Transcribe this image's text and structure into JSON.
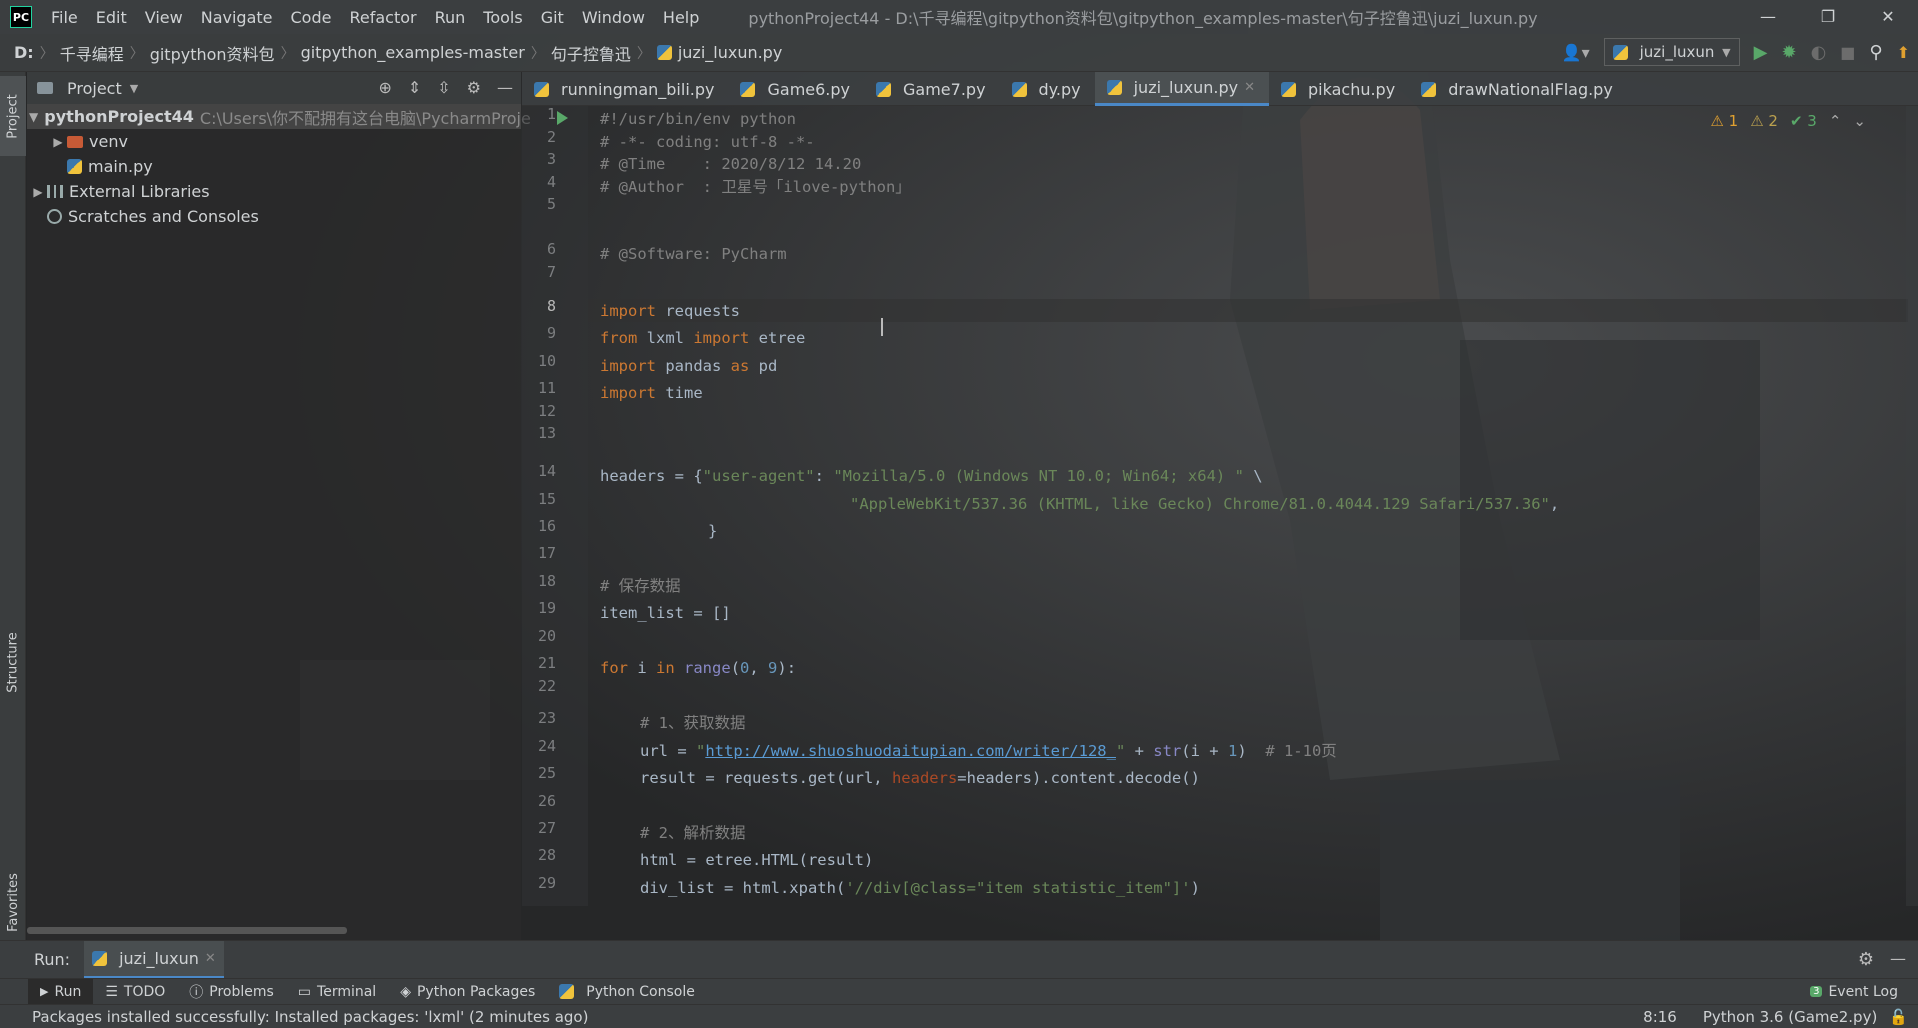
{
  "titlebar": {
    "logo": "PC",
    "menus": [
      "File",
      "Edit",
      "View",
      "Navigate",
      "Code",
      "Refactor",
      "Run",
      "Tools",
      "Git",
      "Window",
      "Help"
    ],
    "title": "pythonProject44 - D:\\千寻编程\\gitpython资料包\\gitpython_examples-master\\句子控鲁迅\\juzi_luxun.py",
    "controls": [
      "—",
      "❐",
      "✕"
    ]
  },
  "navbar": {
    "crumbs": [
      "D:",
      "千寻编程",
      "gitpython资料包",
      "gitpython_examples-master",
      "句子控鲁迅",
      "juzi_luxun.py"
    ],
    "run_config": "juzi_luxun"
  },
  "stripe": {
    "project": "Project",
    "structure": "Structure",
    "favorites": "Favorites"
  },
  "project": {
    "header": "Project",
    "root": "pythonProject44",
    "root_path": "C:\\Users\\你不配拥有这台电脑\\PycharmProje",
    "venv": "venv",
    "main": "main.py",
    "ext_libs": "External Libraries",
    "scratches": "Scratches and Consoles"
  },
  "tabs": [
    "runningman_bili.py",
    "Game6.py",
    "Game7.py",
    "dy.py",
    "juzi_luxun.py",
    "pikachu.py",
    "drawNationalFlag.py"
  ],
  "active_tab": "juzi_luxun.py",
  "inspections": {
    "warnings": "1",
    "weak": "2",
    "ok": "3"
  },
  "code": {
    "l1": "#!/usr/bin/env python",
    "l2": "# -*- coding: utf-8 -*-",
    "l3": "# @Time    : 2020/8/12 14.20",
    "l4": "# @Author  : 卫星号「ilove-python」",
    "l6": "# @Software: PyCharm",
    "l8_kw": "import",
    "l8_rest": " requests",
    "l9_kw1": "from",
    "l9_mid": " lxml ",
    "l9_kw2": "import",
    "l9_rest": " etree",
    "l10_kw1": "import",
    "l10_mid": " pandas ",
    "l10_kw2": "as",
    "l10_rest": " pd",
    "l11_kw": "import",
    "l11_rest": " time",
    "l14_a": "headers = {",
    "l14_s1": "\"user-agent\"",
    "l14_b": ": ",
    "l14_s2": "\"Mozilla/5.0 (Windows NT 10.0; Win64; x64) \"",
    "l14_c": " \\",
    "l15_s": "\"AppleWebKit/537.36 (KHTML, like Gecko) Chrome/81.0.4044.129 Safari/537.36\"",
    "l15_c": ",",
    "l16": "}",
    "l18": "# 保存数据",
    "l19": "item_list = []",
    "l21_kw1": "for",
    "l21_a": " i ",
    "l21_kw2": "in",
    "l21_b": " ",
    "l21_bi": "range",
    "l21_c": "(",
    "l21_n1": "0",
    "l21_d": ", ",
    "l21_n2": "9",
    "l21_e": "):",
    "l23": "# 1、获取数据",
    "l24_a": "url = ",
    "l24_q1": "\"",
    "l24_link": "http://www.shuoshuodaitupian.com/writer/128_",
    "l24_q2": "\"",
    "l24_b": " + ",
    "l24_bi": "str",
    "l24_c": "(i + ",
    "l24_n": "1",
    "l24_d": ")  ",
    "l24_cm": "# 1-10页",
    "l25_a": "result = requests.get(url, ",
    "l25_pm": "headers",
    "l25_b": "=headers).content.decode()",
    "l27": "# 2、解析数据",
    "l28": "html = etree.HTML(result)",
    "l29_a": "div_list = html.xpath(",
    "l29_s": "'//div[@class=\"item statistic_item\"]'",
    "l29_b": ")"
  },
  "line_numbers": [
    "1",
    "2",
    "3",
    "4",
    "5",
    "6",
    "7",
    "8",
    "9",
    "10",
    "11",
    "12",
    "13",
    "14",
    "15",
    "16",
    "17",
    "18",
    "19",
    "20",
    "21",
    "22",
    "23",
    "24",
    "25",
    "26",
    "27",
    "28",
    "29"
  ],
  "run": {
    "label": "Run:",
    "tab": "juzi_luxun"
  },
  "toolwindows": [
    "Run",
    "TODO",
    "Problems",
    "Terminal",
    "Python Packages",
    "Python Console"
  ],
  "event_log": {
    "count": "3",
    "label": "Event Log"
  },
  "status": {
    "message": "Packages installed successfully: Installed packages: 'lxml' (2 minutes ago)",
    "position": "8:16",
    "interpreter": "Python 3.6 (Game2.py)"
  },
  "colors": {
    "keyword": "#cc7832",
    "string": "#6a8759",
    "number": "#6897bb",
    "comment": "#808080",
    "accent": "#4a88c7"
  }
}
